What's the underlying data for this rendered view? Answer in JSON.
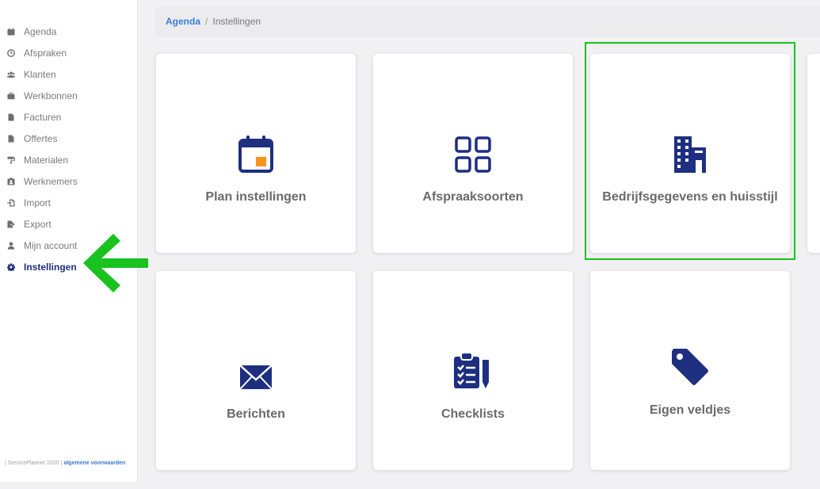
{
  "sidebar": {
    "items": [
      {
        "label": "Agenda",
        "icon": "calendar-icon"
      },
      {
        "label": "Afspraken",
        "icon": "clock-icon"
      },
      {
        "label": "Klanten",
        "icon": "users-icon"
      },
      {
        "label": "Werkbonnen",
        "icon": "briefcase-icon"
      },
      {
        "label": "Facturen",
        "icon": "file-icon"
      },
      {
        "label": "Offertes",
        "icon": "file-icon"
      },
      {
        "label": "Materialen",
        "icon": "paint-roller-icon"
      },
      {
        "label": "Werknemers",
        "icon": "id-badge-icon"
      },
      {
        "label": "Import",
        "icon": "import-icon"
      },
      {
        "label": "Export",
        "icon": "export-icon"
      },
      {
        "label": "Mijn account",
        "icon": "user-icon"
      },
      {
        "label": "Instellingen",
        "icon": "gear-icon",
        "active": true
      }
    ],
    "footer": {
      "copyright": "| ServicePlanner 2020 |",
      "terms_link": "algemene voorwaarden"
    }
  },
  "breadcrumb": {
    "root": "Agenda",
    "separator": "/",
    "current": "Instellingen"
  },
  "cards": [
    {
      "label": "Plan instellingen",
      "icon": "calendar-icon"
    },
    {
      "label": "Afspraaksoorten",
      "icon": "grid-icon"
    },
    {
      "label": "Bedrijfsgegevens en huisstijl",
      "icon": "building-icon",
      "highlighted": true
    },
    {
      "label": "Berichten",
      "icon": "envelope-icon"
    },
    {
      "label": "Checklists",
      "icon": "clipboard-check-icon"
    },
    {
      "label": "Eigen veldjes",
      "icon": "tag-icon"
    }
  ],
  "colors": {
    "accent_navy": "#1e2f80",
    "link_blue": "#3a7bd5",
    "highlight_green": "#19c21f",
    "calendar_orange": "#f7941d"
  }
}
